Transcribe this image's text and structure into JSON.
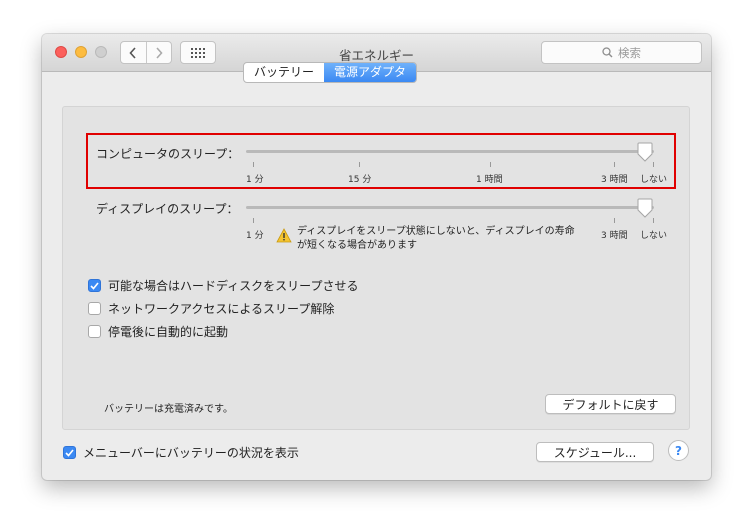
{
  "window": {
    "title": "省エネルギー"
  },
  "toolbar": {
    "back_icon": "chevron-left-icon",
    "forward_icon": "chevron-right-icon",
    "grid_icon": "grid-icon",
    "search_placeholder": "検索"
  },
  "tabs": [
    {
      "label": "バッテリー",
      "active": false
    },
    {
      "label": "電源アダプタ",
      "active": true
    }
  ],
  "computer_sleep": {
    "label": "コンピュータのスリープ：",
    "ticks": [
      "1 分",
      "15 分",
      "1 時間",
      "3 時間",
      "しない"
    ],
    "value": "しない"
  },
  "display_sleep": {
    "label": "ディスプレイのスリープ：",
    "ticks": [
      "1 分",
      "3 時間",
      "しない"
    ],
    "value": "しない",
    "warning_line1": "ディスプレイをスリープ状態にしないと、ディスプレイの寿命",
    "warning_line2": "が短くなる場合があります"
  },
  "options": [
    {
      "label": "可能な場合はハードディスクをスリープさせる",
      "checked": true
    },
    {
      "label": "ネットワークアクセスによるスリープ解除",
      "checked": false
    },
    {
      "label": "停電後に自動的に起動",
      "checked": false
    }
  ],
  "status_text": "バッテリーは充電済みです。",
  "default_button": "デフォルトに戻す",
  "show_battery_status": {
    "label": "メニューバーにバッテリーの状況を表示",
    "checked": true
  },
  "schedule_button": "スケジュール...",
  "help_label": "?",
  "colors": {
    "accent": "#3b89f3",
    "highlight": "#e00000"
  }
}
